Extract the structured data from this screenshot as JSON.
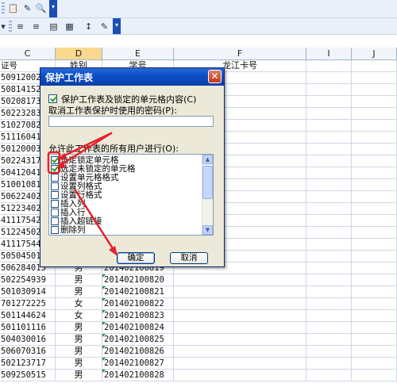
{
  "toolbars": {
    "top_icons": [
      "paste-icon",
      "format-painter-icon",
      "find-icon"
    ],
    "format_icons": [
      "align-left-icon",
      "align-center-icon",
      "merge-icon",
      "borders-icon",
      "fill-icon"
    ]
  },
  "columns": [
    {
      "letter": "C",
      "header": "证号"
    },
    {
      "letter": "D",
      "header": "姓别"
    },
    {
      "letter": "E",
      "header": "学号"
    },
    {
      "letter": "F",
      "header": "龙江卡号"
    },
    {
      "letter": "I",
      "header": ""
    },
    {
      "letter": "J",
      "header": ""
    }
  ],
  "rows": [
    {
      "c": "509120027",
      "d": "",
      "e": ""
    },
    {
      "c": "508141529",
      "d": "",
      "e": ""
    },
    {
      "c": "502081739",
      "d": "",
      "e": ""
    },
    {
      "c": "502232833",
      "d": "",
      "e": ""
    },
    {
      "c": "510270820",
      "d": "",
      "e": ""
    },
    {
      "c": "511160415",
      "d": "",
      "e": ""
    },
    {
      "c": "501200030",
      "d": "",
      "e": ""
    },
    {
      "c": "502243178",
      "d": "",
      "e": ""
    },
    {
      "c": "504120419",
      "d": "",
      "e": ""
    },
    {
      "c": "510010814",
      "d": "",
      "e": ""
    },
    {
      "c": "506224020",
      "d": "",
      "e": ""
    },
    {
      "c": "512234022",
      "d": "",
      "e": ""
    },
    {
      "c": "411175422",
      "d": "",
      "e": ""
    },
    {
      "c": "512245020",
      "d": "",
      "e": ""
    },
    {
      "c": "411175449",
      "d": "",
      "e": ""
    },
    {
      "c": "505045011X",
      "d": "",
      "e": ""
    },
    {
      "c": "506284015",
      "d": "男",
      "e": "201402100819"
    },
    {
      "c": "502254939",
      "d": "男",
      "e": "201402100820"
    },
    {
      "c": "501030914",
      "d": "男",
      "e": "201402100821"
    },
    {
      "c": "701272225",
      "d": "女",
      "e": "201402100822"
    },
    {
      "c": "501144624",
      "d": "女",
      "e": "201402100823"
    },
    {
      "c": "501101116",
      "d": "男",
      "e": "201402100824"
    },
    {
      "c": "504030016",
      "d": "男",
      "e": "201402100825"
    },
    {
      "c": "506070316",
      "d": "男",
      "e": "201402100826"
    },
    {
      "c": "502123717",
      "d": "男",
      "e": "201402100827"
    },
    {
      "c": "509250515",
      "d": "男",
      "e": "201402100828"
    }
  ],
  "dialog": {
    "title": "保护工作表",
    "protect_label": "保护工作表及锁定的单元格内容(C)",
    "password_label": "取消工作表保护时使用的密码(P):",
    "password_value": "",
    "allow_label": "允许此工作表的所有用户进行(O):",
    "options": [
      {
        "label": "选定锁定单元格",
        "checked": true
      },
      {
        "label": "选定未锁定的单元格",
        "checked": true
      },
      {
        "label": "设置单元格格式",
        "checked": false
      },
      {
        "label": "设置列格式",
        "checked": false
      },
      {
        "label": "设置行格式",
        "checked": false
      },
      {
        "label": "插入列",
        "checked": false
      },
      {
        "label": "插入行",
        "checked": false
      },
      {
        "label": "插入超链接",
        "checked": false
      },
      {
        "label": "删除列",
        "checked": false
      }
    ],
    "ok_label": "确定",
    "cancel_label": "取消"
  },
  "colors": {
    "selected_column": "#f9d98f",
    "annotation_red": "#e8202a",
    "title_blue": "#0c4fc7"
  }
}
